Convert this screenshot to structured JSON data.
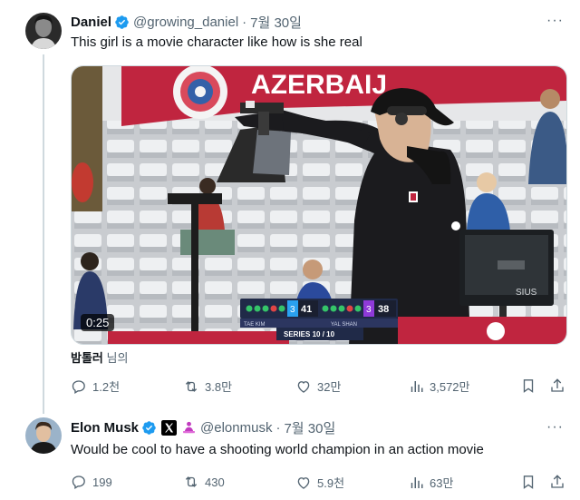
{
  "tweet1": {
    "display_name": "Daniel",
    "handle": "@growing_daniel",
    "separator": "·",
    "date": "7월 30일",
    "text": "This girl is a movie character like how is she real",
    "media": {
      "video_duration": "0:25",
      "banner_text": "AZERBAIJ",
      "scoreboard": {
        "left_label": "TAE KIM",
        "left_score": "41",
        "left_seed": "3",
        "right_label": "YAL SHAN",
        "right_score": "38",
        "right_seed": "3",
        "series": "SERIES 10 / 10"
      },
      "monitor_brand": "SIUS"
    },
    "credit_name": "밤톨러",
    "credit_suffix": "님의",
    "stats": {
      "replies": "1.2천",
      "reposts": "3.8만",
      "likes": "32만",
      "views": "3,572만"
    }
  },
  "tweet2": {
    "display_name": "Elon Musk",
    "handle": "@elonmusk",
    "separator": "·",
    "date": "7월 30일",
    "text": "Would be cool to have a shooting world champion in an action movie",
    "stats": {
      "replies": "199",
      "reposts": "430",
      "likes": "5.9천",
      "views": "63만"
    }
  },
  "more_label": "···",
  "colors": {
    "verified_blue": "#1d9bf0",
    "secondary_text": "#536471",
    "primary_text": "#0f1419",
    "divider": "#cfd9de",
    "banner_red": "#c0253f"
  }
}
